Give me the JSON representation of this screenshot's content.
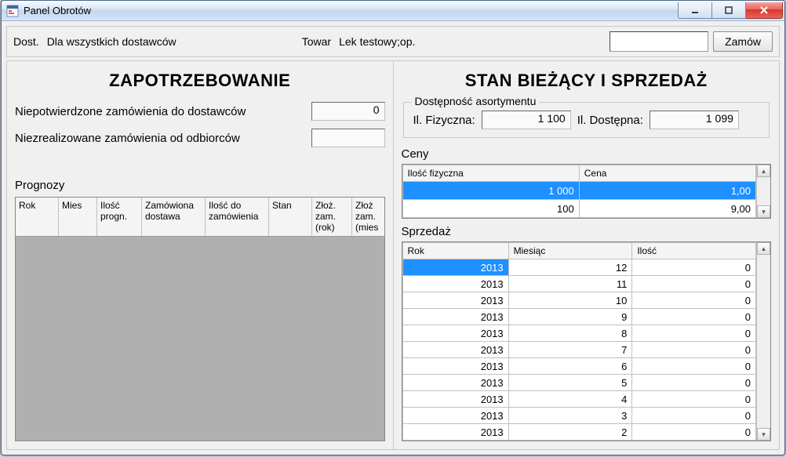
{
  "window": {
    "title": "Panel Obrotów"
  },
  "toolbar": {
    "dost_label": "Dost.",
    "supplier_value": "Dla wszystkich dostawców",
    "towar_label": "Towar",
    "towar_value": "Lek testowy;op.",
    "qty_value": "",
    "order_label": "Zamów"
  },
  "left": {
    "title": "ZAPOTRZEBOWANIE",
    "unconfirmed_label": "Niepotwierdzone zamówienia do dostawców",
    "unconfirmed_value": "0",
    "unfulfilled_label": "Niezrealizowane zamówienia od odbiorców",
    "unfulfilled_value": "",
    "prognozy_label": "Prognozy",
    "headers": {
      "rok": "Rok",
      "mies": "Mies",
      "ilosc_progn": "Ilość\nprogn.",
      "zamowiona_dostawa": "Zamówiona\ndostawa",
      "ilosc_do_zam": "Ilość do\nzamówienia",
      "stan": "Stan",
      "zloz_rok": "Złoż.\nzam.\n(rok)",
      "zloz_mies": "Złoż\nzam.\n(mies"
    }
  },
  "right": {
    "title": "STAN BIEŻĄCY I SPRZEDAŻ",
    "group_legend": "Dostępność asortymentu",
    "fizyczna_label": "Il. Fizyczna:",
    "fizyczna_value": "1 100",
    "dostepna_label": "Il. Dostępna:",
    "dostepna_value": "1 099",
    "ceny_label": "Ceny",
    "ceny_headers": {
      "ilosc": "Ilość fizyczna",
      "cena": "Cena"
    },
    "ceny_rows": [
      {
        "ilosc": "1 000",
        "cena": "1,00",
        "selected": true
      },
      {
        "ilosc": "100",
        "cena": "9,00",
        "selected": false
      }
    ],
    "sprzedaz_label": "Sprzedaż",
    "sprzedaz_headers": {
      "rok": "Rok",
      "miesiac": "Miesiąc",
      "ilosc": "Ilość"
    },
    "sprzedaz_rows": [
      {
        "rok": "2013",
        "miesiac": "12",
        "ilosc": "0",
        "selected": true
      },
      {
        "rok": "2013",
        "miesiac": "11",
        "ilosc": "0"
      },
      {
        "rok": "2013",
        "miesiac": "10",
        "ilosc": "0"
      },
      {
        "rok": "2013",
        "miesiac": "9",
        "ilosc": "0"
      },
      {
        "rok": "2013",
        "miesiac": "8",
        "ilosc": "0"
      },
      {
        "rok": "2013",
        "miesiac": "7",
        "ilosc": "0"
      },
      {
        "rok": "2013",
        "miesiac": "6",
        "ilosc": "0"
      },
      {
        "rok": "2013",
        "miesiac": "5",
        "ilosc": "0"
      },
      {
        "rok": "2013",
        "miesiac": "4",
        "ilosc": "0"
      },
      {
        "rok": "2013",
        "miesiac": "3",
        "ilosc": "0"
      },
      {
        "rok": "2013",
        "miesiac": "2",
        "ilosc": "0"
      }
    ]
  }
}
